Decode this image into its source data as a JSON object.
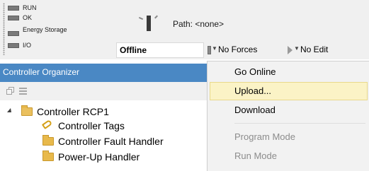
{
  "status_indicators": [
    {
      "label": "RUN"
    },
    {
      "label": "OK"
    },
    {
      "label": "Energy Storage"
    },
    {
      "label": "I/O"
    }
  ],
  "path": {
    "label": "Path: <none>"
  },
  "mode": {
    "value": "Offline"
  },
  "forces": {
    "value": "No Forces"
  },
  "edits": {
    "value": "No Edit"
  },
  "organizer": {
    "title": "Controller Organizer",
    "tree": [
      {
        "label": "Controller RCP1",
        "icon": "open-folder-icon",
        "expanded": true
      },
      {
        "label": "Controller Tags",
        "icon": "tag-icon"
      },
      {
        "label": "Controller Fault Handler",
        "icon": "folder-icon"
      },
      {
        "label": "Power-Up Handler",
        "icon": "folder-icon"
      }
    ]
  },
  "menu": {
    "items": [
      {
        "label": "Go Online",
        "enabled": true,
        "highlighted": false
      },
      {
        "label": "Upload...",
        "enabled": true,
        "highlighted": true
      },
      {
        "label": "Download",
        "enabled": true,
        "highlighted": false
      },
      {
        "label": "Program Mode",
        "enabled": false,
        "highlighted": false
      },
      {
        "label": "Run Mode",
        "enabled": false,
        "highlighted": false
      }
    ]
  },
  "colors": {
    "organizer_header": "#4a88c4",
    "menu_highlight": "#fbf3c6",
    "led_off": "#7a7a7a"
  }
}
